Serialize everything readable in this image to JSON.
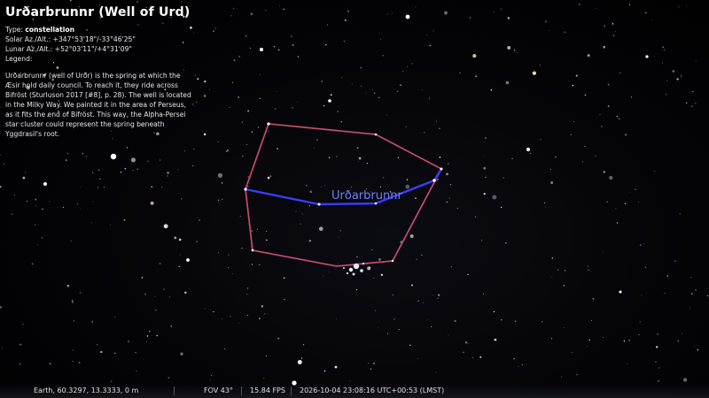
{
  "info_panel": {
    "title": "Urðarbrunnr (Well of Urd)",
    "type_label": "Type:",
    "type_value": "constellation",
    "solar": "Solar Az./Alt.: +347°53'18\"/-33°46'25\"",
    "lunar": "Lunar Az./Alt.: +52°03'11\"/+4°31'09\"",
    "legend_label": "Legend:",
    "description": "Urðarbrunnr (well of Urðr) is the spring at which the Æsir hold daily council. To reach it, they ride across Bifröst (Sturluson 2017 [#8], p. 28). The well is located in the Milky Way. We painted it in the area of Perseus, as it fits the end of Bifröst. This way, the Alpha-Persei star cluster could represent the spring beneath Yggdrasil's root."
  },
  "constellation": {
    "label": "Urðarbrunnr",
    "label_color": "#6f7fff",
    "boundary_color": "#c04a6a",
    "line_color": "#3c3cff"
  },
  "status_bar": {
    "location": "Earth, 60.3297, 13.3333, 0 m",
    "fov": "FOV 43°",
    "fps": "15.84 FPS",
    "datetime": "2026-10-04 23:08:16 UTC+00:53 (LMST)"
  }
}
